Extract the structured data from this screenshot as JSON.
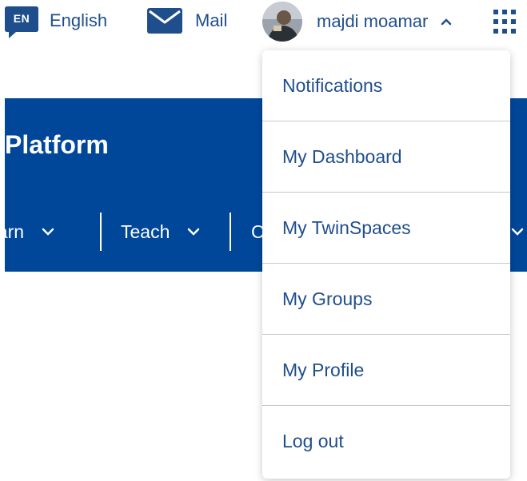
{
  "topbar": {
    "language": {
      "code": "EN",
      "label": "English",
      "icon": "speech-bubble-icon"
    },
    "mail": {
      "label": "Mail",
      "icon": "envelope-icon"
    },
    "user": {
      "name": "majdi moamar",
      "icon": "chevron-up-icon"
    },
    "apps_icon": "grid-dots-icon"
  },
  "banner": {
    "title": "Platform",
    "nav": [
      {
        "label": "earn"
      },
      {
        "label": "Teach"
      },
      {
        "label": "C"
      }
    ]
  },
  "dropdown": {
    "items": [
      {
        "label": "Notifications"
      },
      {
        "label": "My Dashboard"
      },
      {
        "label": "My TwinSpaces"
      },
      {
        "label": "My Groups"
      },
      {
        "label": "My Profile"
      },
      {
        "label": "Log out"
      }
    ]
  },
  "colors": {
    "brand_blue": "#00479a",
    "link_blue": "#1f4e8c",
    "white": "#ffffff"
  }
}
